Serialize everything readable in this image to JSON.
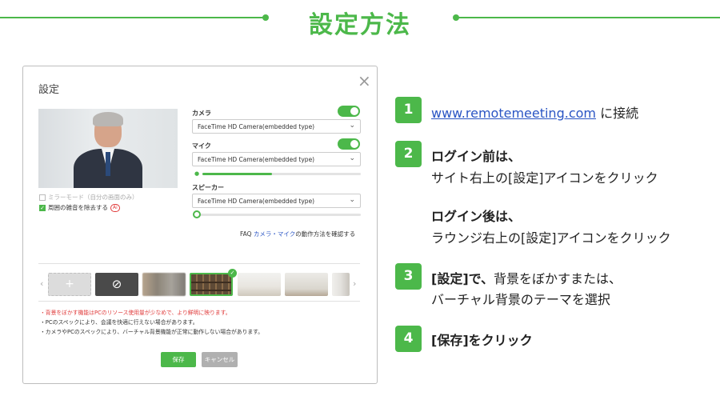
{
  "header": {
    "title": "設定方法"
  },
  "dialog": {
    "title": "設定",
    "close_icon": "×",
    "camera": {
      "label": "カメラ",
      "enabled": true,
      "device": "FaceTime HD Camera(embedded type)"
    },
    "mic": {
      "label": "マイク",
      "enabled": true,
      "device": "FaceTime HD Camera(embedded type)",
      "level": 0.44
    },
    "speaker": {
      "label": "スピーカー",
      "device": "FaceTime HD Camera(embedded type)",
      "volume": 0.0
    },
    "mirror_label": "ミラーモード（自分の画面のみ）",
    "noise_label": "周囲の雑音を除去する",
    "ai_badge": "Ai",
    "faq": {
      "prefix": "FAQ ",
      "highlight": "カメラ・マイク",
      "suffix": "の動作方法を確認する"
    },
    "backgrounds": {
      "add_symbol": "+",
      "none_symbol": "⊘",
      "selected": "bookshelf",
      "prev": "‹",
      "next": "›"
    },
    "notes": [
      "・背景をぼかす機能はPCのリソース使用量が少なめで、より鮮明に映ります。",
      "・PCのスペックにより、会議を快適に行えない場合があります。",
      "・カメラやPCのスペックにより、バーチャル背景機能が正常に動作しない場合があります。"
    ],
    "save_label": "保存",
    "cancel_label": "キャンセル"
  },
  "steps": [
    {
      "num": "1",
      "link": "www.remotemeeting.com",
      "text": " に接続"
    },
    {
      "num": "2",
      "bold1": "ログイン前は、",
      "line1": "サイト右上の[設定]アイコンをクリック",
      "bold2": "ログイン後は、",
      "line2": "ラウンジ右上の[設定]アイコンをクリック"
    },
    {
      "num": "3",
      "bold": "[設定]で、",
      "text": "背景をぼかすまたは、",
      "line2": "バーチャル背景のテーマを選択"
    },
    {
      "num": "4",
      "bold": "[保存]をクリック"
    }
  ],
  "colors": {
    "accent": "#4cb84a",
    "link": "#2a55c4",
    "warning": "#e03b3b"
  }
}
